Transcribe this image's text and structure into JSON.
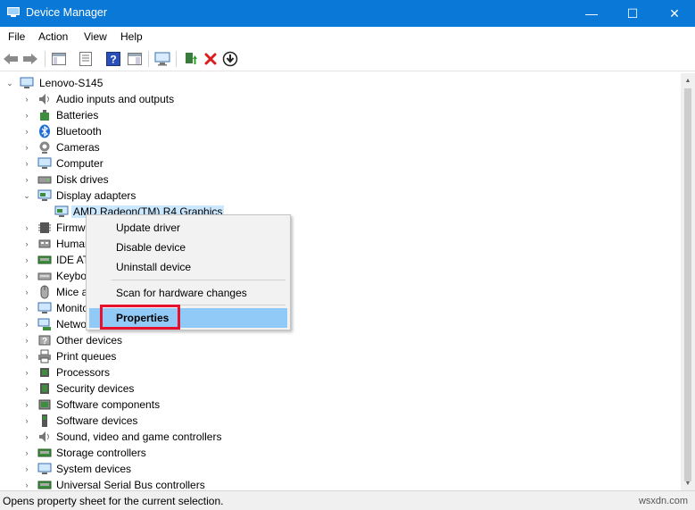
{
  "window": {
    "title": "Device Manager",
    "minimize_glyph": "—",
    "maximize_glyph": "☐",
    "close_glyph": "✕"
  },
  "menu": [
    "File",
    "Action",
    "View",
    "Help"
  ],
  "toolbar_icons": [
    "back-arrow-icon",
    "forward-arrow-icon",
    "show-hide-console-tree-icon",
    "properties-icon",
    "help-icon",
    "action-pane-icon",
    "scan-hardware-icon",
    "update-driver-icon",
    "uninstall-icon",
    "download-icon"
  ],
  "tree": {
    "root": "Lenovo-S145",
    "categories": [
      "Audio inputs and outputs",
      "Batteries",
      "Bluetooth",
      "Cameras",
      "Computer",
      "Disk drives",
      "Display adapters",
      "Firmware",
      "Human Interface Devices",
      "IDE ATA/ATAPI controllers",
      "Keyboards",
      "Mice and other pointing devices",
      "Monitors",
      "Network adapters",
      "Other devices",
      "Print queues",
      "Processors",
      "Security devices",
      "Software components",
      "Software devices",
      "Sound, video and game controllers",
      "Storage controllers",
      "System devices",
      "Universal Serial Bus controllers"
    ],
    "selected_device": "AMD Radeon(TM) R4 Graphics"
  },
  "context_menu": {
    "items": [
      "Update driver",
      "Disable device",
      "Uninstall device",
      "Scan for hardware changes",
      "Properties"
    ],
    "highlighted": "Properties"
  },
  "status": {
    "text": "Opens property sheet for the current selection.",
    "watermark": "wsxdn.com"
  },
  "colors": {
    "title_bar": "#0a78d7",
    "selection": "#cce8ff",
    "menu_highlight": "#91c9f7",
    "annotation_box": "#e8112d"
  }
}
